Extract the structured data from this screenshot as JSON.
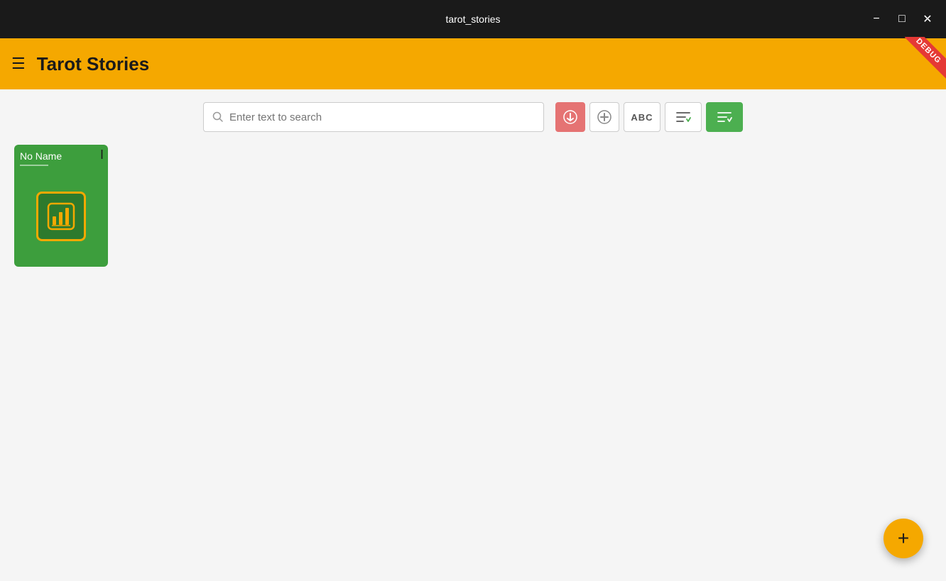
{
  "window": {
    "title": "tarot_stories",
    "minimize_label": "−",
    "maximize_label": "□",
    "close_label": "✕"
  },
  "header": {
    "menu_icon": "☰",
    "app_title": "Tarot Stories",
    "debug_label": "DEBUG"
  },
  "toolbar": {
    "search_placeholder": "Enter text to search",
    "search_icon": "🔍",
    "btn_primary_icon": "⊙",
    "btn_add_icon": "⊕",
    "btn_text_label": "ABC",
    "btn_filter_label": "≡✓",
    "btn_checkall_label": "≡✓"
  },
  "cards": [
    {
      "name": "No Name",
      "icon_type": "bar-chart"
    }
  ],
  "fab": {
    "label": "+"
  }
}
